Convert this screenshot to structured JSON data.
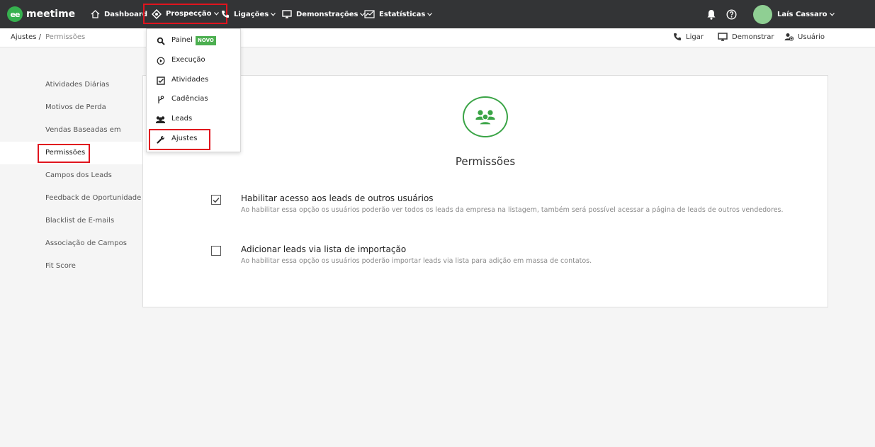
{
  "app": {
    "logo_mark": "ee",
    "logo_text": "meetime"
  },
  "nav": {
    "dashboard": "Dashboard",
    "prospeccao": "Prospecção",
    "ligacoes": "Ligações",
    "demonstracoes": "Demonstrações",
    "estatisticas": "Estatísticas"
  },
  "user": {
    "name": "Laís Cassaro"
  },
  "breadcrumb": {
    "root": "Ajustes /",
    "current": "Permissões"
  },
  "sub_actions": {
    "ligar": "Ligar",
    "demonstrar": "Demonstrar",
    "usuario": "Usuário"
  },
  "sidebar": {
    "items": [
      {
        "label": "Atividades Diárias"
      },
      {
        "label": "Motivos de Perda"
      },
      {
        "label": "Vendas Baseadas em Contas"
      },
      {
        "label": "Permissões"
      },
      {
        "label": "Campos dos Leads"
      },
      {
        "label": "Feedback de Oportunidade"
      },
      {
        "label": "Blacklist de E-mails"
      },
      {
        "label": "Associação de Campos"
      },
      {
        "label": "Fit Score"
      }
    ],
    "active_index": 3
  },
  "dropdown": {
    "items": [
      {
        "label": "Painel",
        "icon": "search-icon",
        "badge": "NOVO"
      },
      {
        "label": "Execução",
        "icon": "play-circle-icon"
      },
      {
        "label": "Atividades",
        "icon": "checkbox-icon"
      },
      {
        "label": "Cadências",
        "icon": "branch-icon"
      },
      {
        "label": "Leads",
        "icon": "users-icon"
      },
      {
        "label": "Ajustes",
        "icon": "wrench-icon"
      }
    ]
  },
  "main": {
    "title": "Permissões",
    "permissions": [
      {
        "title": "Habilitar acesso aos leads de outros usuários",
        "description": "Ao habilitar essa opção os usuários poderão ver todos os leads da empresa na listagem, também será possível acessar a página de leads de outros vendedores.",
        "checked": true
      },
      {
        "title": "Adicionar leads via lista de importação",
        "description": "Ao habilitar essa opção os usuários poderão importar leads via lista para adição em massa de contatos.",
        "checked": false
      }
    ]
  },
  "colors": {
    "topbar": "#333436",
    "brand_green": "#36b14f",
    "highlight_red": "#e0141e",
    "badge_green": "#4caf50"
  }
}
